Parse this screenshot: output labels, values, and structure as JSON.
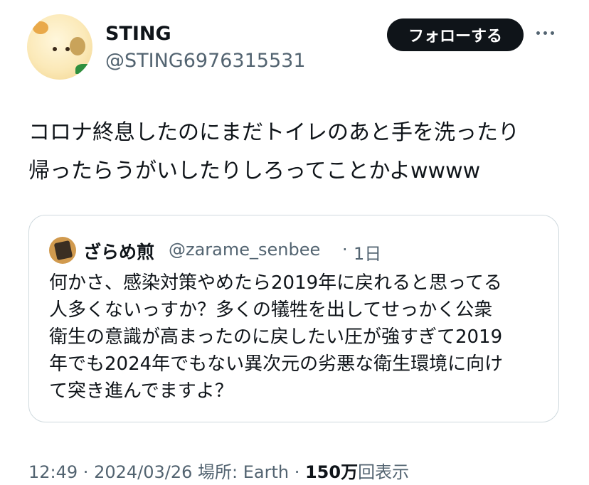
{
  "author": {
    "display_name": "STING",
    "handle": "@STING6976315531",
    "follow_label": "フォローする"
  },
  "tweet": {
    "lines": [
      "コロナ終息したのにまだトイレのあと手を洗ったり",
      "帰ったらうがいしたりしろってことかよwwww"
    ]
  },
  "quote": {
    "display_name": "ざらめ煎",
    "handle": "@zarame_senbee",
    "separator": "·",
    "time": "1日",
    "lines": [
      "何かさ、感染対策やめたら2019年に戻れると思ってる",
      "人多くないっすか？多くの犠牲を出してせっかく公衆",
      "衛生の意識が高まったのに戻したい圧が強すぎて2019",
      "年でも2024年でもない異次元の劣悪な衛生環境に向け",
      "て突き進んでますよ？"
    ]
  },
  "meta": {
    "time": "12:49",
    "sep1": " · ",
    "date": "2024/03/26",
    "location": " 場所: Earth",
    "sep2": " · ",
    "views_count": "150万",
    "views_label": "回表示"
  },
  "colors": {
    "text_primary": "#0f1419",
    "text_secondary": "#536471",
    "border": "#cfd9de",
    "button_bg": "#0f1419"
  }
}
